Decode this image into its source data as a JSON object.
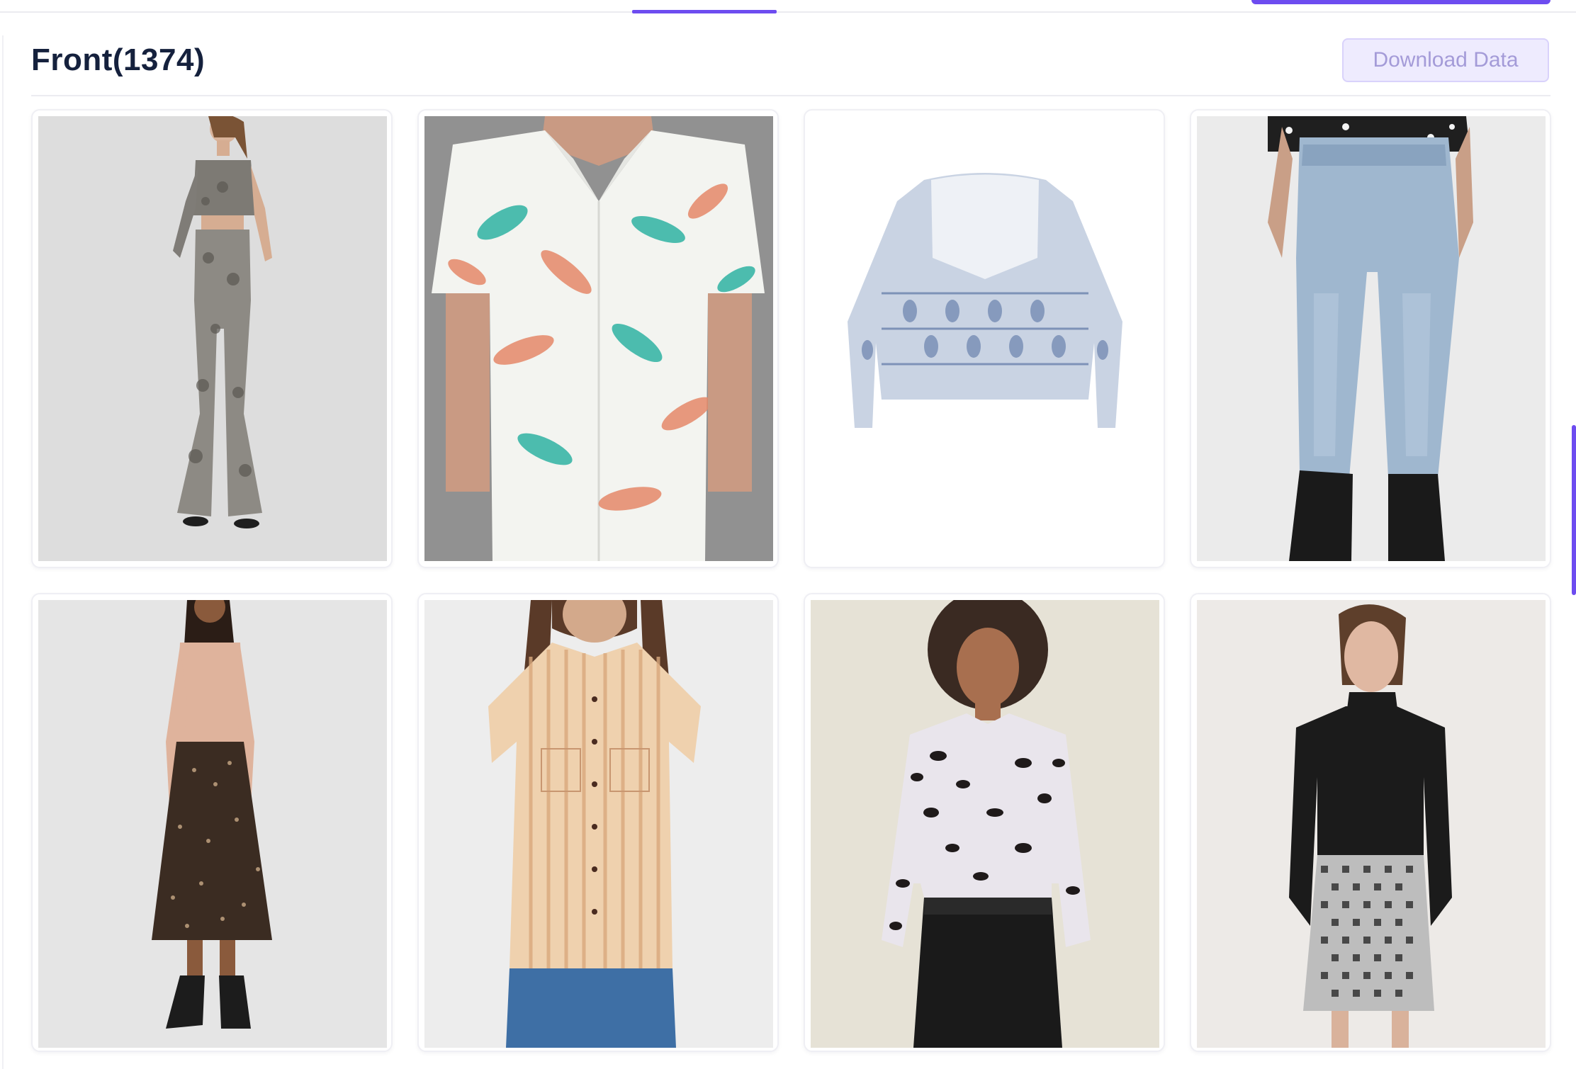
{
  "section": {
    "title": "Front(1374)",
    "download_label": "Download Data"
  },
  "colors": {
    "accent": "#6d4cf0",
    "title": "#15213d",
    "button_bg": "#eeebfe",
    "button_text": "#a49bd8"
  },
  "products": [
    {
      "description": "snakeskin print bandeau top and flared trousers",
      "background": "#dcdcdc"
    },
    {
      "description": "tropical leaf print short sleeve shirt",
      "background": "#8c8c8c"
    },
    {
      "description": "blue paisley print lace yoke blouse",
      "background": "#ffffff"
    },
    {
      "description": "light blue mom jeans with ankle boots",
      "background": "#e8e8e8"
    },
    {
      "description": "pink ribbed top and leopard print midi skirt",
      "background": "#e6e6e6"
    },
    {
      "description": "orange stripe button front shirt",
      "background": "#ececec"
    },
    {
      "description": "leopard print shirt with leather skirt",
      "background": "#e7e3d8"
    },
    {
      "description": "black roll neck top and houndstooth skirt",
      "background": "#ece9e6"
    }
  ]
}
